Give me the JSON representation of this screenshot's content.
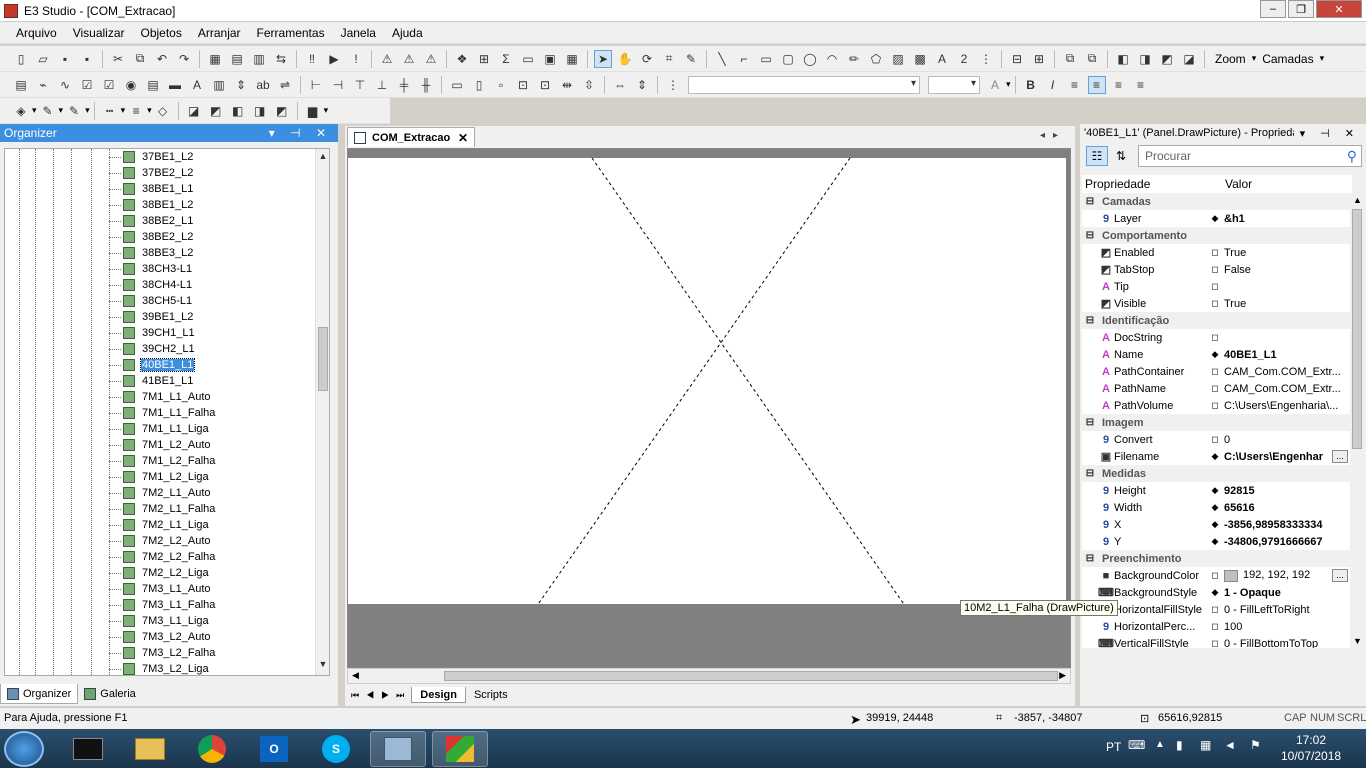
{
  "window": {
    "title": "E3 Studio - [COM_Extracao]"
  },
  "menu": [
    "Arquivo",
    "Visualizar",
    "Objetos",
    "Arranjar",
    "Ferramentas",
    "Janela",
    "Ajuda"
  ],
  "toolbar": {
    "zoom_label": "Zoom",
    "layers_label": "Camadas",
    "font_glyph": "A",
    "bold": "B",
    "italic": "I",
    "underline_glyph": "A"
  },
  "organizer": {
    "title": "Organizer",
    "items": [
      "37BE1_L2",
      "37BE2_L2",
      "38BE1_L1",
      "38BE1_L2",
      "38BE2_L1",
      "38BE2_L2",
      "38BE3_L2",
      "38CH3-L1",
      "38CH4-L1",
      "38CH5-L1",
      "39BE1_L2",
      "39CH1_L1",
      "39CH2_L1",
      "40BE1_L1",
      "41BE1_L1",
      "7M1_L1_Auto",
      "7M1_L1_Falha",
      "7M1_L1_Liga",
      "7M1_L2_Auto",
      "7M1_L2_Falha",
      "7M1_L2_Liga",
      "7M2_L1_Auto",
      "7M2_L1_Falha",
      "7M2_L1_Liga",
      "7M2_L2_Auto",
      "7M2_L2_Falha",
      "7M2_L2_Liga",
      "7M3_L1_Auto",
      "7M3_L1_Falha",
      "7M3_L1_Liga",
      "7M3_L2_Auto",
      "7M3_L2_Falha",
      "7M3_L2_Liga"
    ],
    "selected": "40BE1_L1",
    "tabs": [
      "Organizer",
      "Galeria"
    ]
  },
  "document": {
    "tab": "COM_Extracao",
    "view_tabs": [
      "Design",
      "Scripts"
    ]
  },
  "properties": {
    "title": "'40BE1_L1' (Panel.DrawPicture) - Propriedad...",
    "search_placeholder": "Procurar",
    "col_property": "Propriedade",
    "col_value": "Valor",
    "rows": [
      {
        "type": "cat",
        "name": "Camadas"
      },
      {
        "type": "prop",
        "icon": "9",
        "name": "Layer",
        "flag": "◆",
        "value": "&h1",
        "bold": true
      },
      {
        "type": "cat",
        "name": "Comportamento"
      },
      {
        "type": "prop",
        "icon": "◩",
        "name": "Enabled",
        "flag": "◻",
        "value": "True"
      },
      {
        "type": "prop",
        "icon": "◩",
        "name": "TabStop",
        "flag": "◻",
        "value": "False"
      },
      {
        "type": "prop",
        "icon": "A",
        "name": "Tip",
        "flag": "◻",
        "value": ""
      },
      {
        "type": "prop",
        "icon": "◩",
        "name": "Visible",
        "flag": "◻",
        "value": "True"
      },
      {
        "type": "cat",
        "name": "Identificação"
      },
      {
        "type": "prop",
        "icon": "A",
        "name": "DocString",
        "flag": "◻",
        "value": ""
      },
      {
        "type": "prop",
        "icon": "A",
        "name": "Name",
        "flag": "◆",
        "value": "40BE1_L1",
        "bold": true
      },
      {
        "type": "prop",
        "icon": "A",
        "name": "PathContainer",
        "flag": "◻",
        "value": "CAM_Com.COM_Extr..."
      },
      {
        "type": "prop",
        "icon": "A",
        "name": "PathName",
        "flag": "◻",
        "value": "CAM_Com.COM_Extr..."
      },
      {
        "type": "prop",
        "icon": "A",
        "name": "PathVolume",
        "flag": "◻",
        "value": "C:\\Users\\Engenharia\\..."
      },
      {
        "type": "cat",
        "name": "Imagem"
      },
      {
        "type": "prop",
        "icon": "9",
        "name": "Convert",
        "flag": "◻",
        "value": "0"
      },
      {
        "type": "prop",
        "icon": "▣",
        "name": "Filename",
        "flag": "◆",
        "value": "C:\\Users\\Engenhar",
        "bold": true,
        "dots": true
      },
      {
        "type": "cat",
        "name": "Medidas"
      },
      {
        "type": "prop",
        "icon": "9",
        "name": "Height",
        "flag": "◆",
        "value": "92815",
        "bold": true
      },
      {
        "type": "prop",
        "icon": "9",
        "name": "Width",
        "flag": "◆",
        "value": "65616",
        "bold": true
      },
      {
        "type": "prop",
        "icon": "9",
        "name": "X",
        "flag": "◆",
        "value": "-3856,98958333334",
        "bold": true
      },
      {
        "type": "prop",
        "icon": "9",
        "name": "Y",
        "flag": "◆",
        "value": "-34806,9791666667",
        "bold": true
      },
      {
        "type": "cat",
        "name": "Preenchimento"
      },
      {
        "type": "prop",
        "icon": "■",
        "name": "BackgroundColor",
        "flag": "◻",
        "value": "192, 192, 192",
        "swatch": "#c0c0c0",
        "dots": true
      },
      {
        "type": "prop",
        "icon": "⌨",
        "name": "BackgroundStyle",
        "flag": "◆",
        "value": "1 - Opaque",
        "bold": true
      },
      {
        "type": "prop",
        "icon": "⌨",
        "name": "HorizontalFillStyle",
        "flag": "◻",
        "value": "0 - FillLeftToRight"
      },
      {
        "type": "prop",
        "icon": "9",
        "name": "HorizontalPerc...",
        "flag": "◻",
        "value": "100"
      },
      {
        "type": "prop",
        "icon": "⌨",
        "name": "VerticalFillStyle",
        "flag": "◻",
        "value": "0 - FillBottomToTop"
      }
    ]
  },
  "tooltip": "10M2_L1_Falha (DrawPicture)",
  "status": {
    "help": "Para Ajuda, pressione F1",
    "cursor": "39919, 24448",
    "pos": "-3857, -34807",
    "size": "65616,92815",
    "cap": "CAP",
    "num": "NUM",
    "scrl": "SCRL"
  },
  "taskbar": {
    "lang": "PT",
    "time": "17:02",
    "date": "10/07/2018"
  },
  "colors": {
    "accent": "#3b8ee0",
    "canvas_bg": "#808080",
    "swatch": "#c0c0c0"
  }
}
